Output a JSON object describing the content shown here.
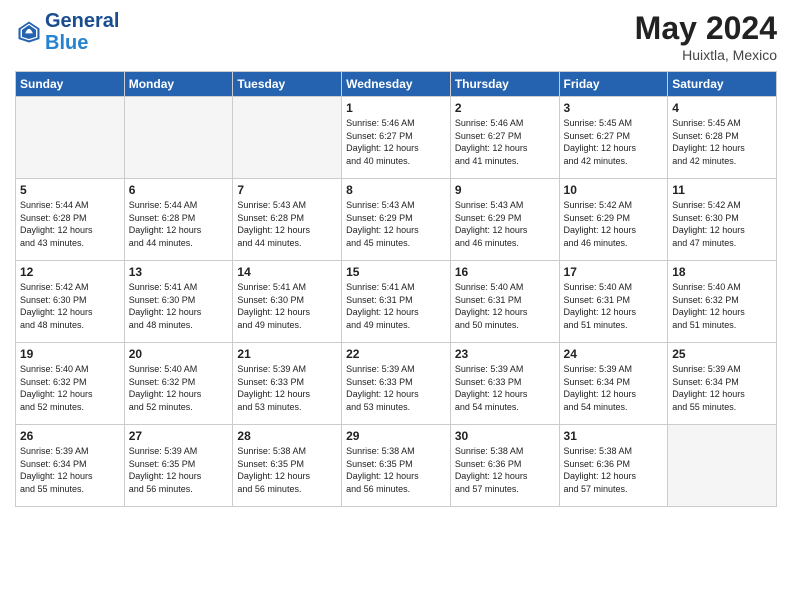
{
  "header": {
    "logo_text_general": "General",
    "logo_text_blue": "Blue",
    "month_year": "May 2024",
    "location": "Huixtla, Mexico"
  },
  "days_of_week": [
    "Sunday",
    "Monday",
    "Tuesday",
    "Wednesday",
    "Thursday",
    "Friday",
    "Saturday"
  ],
  "weeks": [
    [
      {
        "num": "",
        "info": ""
      },
      {
        "num": "",
        "info": ""
      },
      {
        "num": "",
        "info": ""
      },
      {
        "num": "1",
        "info": "Sunrise: 5:46 AM\nSunset: 6:27 PM\nDaylight: 12 hours\nand 40 minutes."
      },
      {
        "num": "2",
        "info": "Sunrise: 5:46 AM\nSunset: 6:27 PM\nDaylight: 12 hours\nand 41 minutes."
      },
      {
        "num": "3",
        "info": "Sunrise: 5:45 AM\nSunset: 6:27 PM\nDaylight: 12 hours\nand 42 minutes."
      },
      {
        "num": "4",
        "info": "Sunrise: 5:45 AM\nSunset: 6:28 PM\nDaylight: 12 hours\nand 42 minutes."
      }
    ],
    [
      {
        "num": "5",
        "info": "Sunrise: 5:44 AM\nSunset: 6:28 PM\nDaylight: 12 hours\nand 43 minutes."
      },
      {
        "num": "6",
        "info": "Sunrise: 5:44 AM\nSunset: 6:28 PM\nDaylight: 12 hours\nand 44 minutes."
      },
      {
        "num": "7",
        "info": "Sunrise: 5:43 AM\nSunset: 6:28 PM\nDaylight: 12 hours\nand 44 minutes."
      },
      {
        "num": "8",
        "info": "Sunrise: 5:43 AM\nSunset: 6:29 PM\nDaylight: 12 hours\nand 45 minutes."
      },
      {
        "num": "9",
        "info": "Sunrise: 5:43 AM\nSunset: 6:29 PM\nDaylight: 12 hours\nand 46 minutes."
      },
      {
        "num": "10",
        "info": "Sunrise: 5:42 AM\nSunset: 6:29 PM\nDaylight: 12 hours\nand 46 minutes."
      },
      {
        "num": "11",
        "info": "Sunrise: 5:42 AM\nSunset: 6:30 PM\nDaylight: 12 hours\nand 47 minutes."
      }
    ],
    [
      {
        "num": "12",
        "info": "Sunrise: 5:42 AM\nSunset: 6:30 PM\nDaylight: 12 hours\nand 48 minutes."
      },
      {
        "num": "13",
        "info": "Sunrise: 5:41 AM\nSunset: 6:30 PM\nDaylight: 12 hours\nand 48 minutes."
      },
      {
        "num": "14",
        "info": "Sunrise: 5:41 AM\nSunset: 6:30 PM\nDaylight: 12 hours\nand 49 minutes."
      },
      {
        "num": "15",
        "info": "Sunrise: 5:41 AM\nSunset: 6:31 PM\nDaylight: 12 hours\nand 49 minutes."
      },
      {
        "num": "16",
        "info": "Sunrise: 5:40 AM\nSunset: 6:31 PM\nDaylight: 12 hours\nand 50 minutes."
      },
      {
        "num": "17",
        "info": "Sunrise: 5:40 AM\nSunset: 6:31 PM\nDaylight: 12 hours\nand 51 minutes."
      },
      {
        "num": "18",
        "info": "Sunrise: 5:40 AM\nSunset: 6:32 PM\nDaylight: 12 hours\nand 51 minutes."
      }
    ],
    [
      {
        "num": "19",
        "info": "Sunrise: 5:40 AM\nSunset: 6:32 PM\nDaylight: 12 hours\nand 52 minutes."
      },
      {
        "num": "20",
        "info": "Sunrise: 5:40 AM\nSunset: 6:32 PM\nDaylight: 12 hours\nand 52 minutes."
      },
      {
        "num": "21",
        "info": "Sunrise: 5:39 AM\nSunset: 6:33 PM\nDaylight: 12 hours\nand 53 minutes."
      },
      {
        "num": "22",
        "info": "Sunrise: 5:39 AM\nSunset: 6:33 PM\nDaylight: 12 hours\nand 53 minutes."
      },
      {
        "num": "23",
        "info": "Sunrise: 5:39 AM\nSunset: 6:33 PM\nDaylight: 12 hours\nand 54 minutes."
      },
      {
        "num": "24",
        "info": "Sunrise: 5:39 AM\nSunset: 6:34 PM\nDaylight: 12 hours\nand 54 minutes."
      },
      {
        "num": "25",
        "info": "Sunrise: 5:39 AM\nSunset: 6:34 PM\nDaylight: 12 hours\nand 55 minutes."
      }
    ],
    [
      {
        "num": "26",
        "info": "Sunrise: 5:39 AM\nSunset: 6:34 PM\nDaylight: 12 hours\nand 55 minutes."
      },
      {
        "num": "27",
        "info": "Sunrise: 5:39 AM\nSunset: 6:35 PM\nDaylight: 12 hours\nand 56 minutes."
      },
      {
        "num": "28",
        "info": "Sunrise: 5:38 AM\nSunset: 6:35 PM\nDaylight: 12 hours\nand 56 minutes."
      },
      {
        "num": "29",
        "info": "Sunrise: 5:38 AM\nSunset: 6:35 PM\nDaylight: 12 hours\nand 56 minutes."
      },
      {
        "num": "30",
        "info": "Sunrise: 5:38 AM\nSunset: 6:36 PM\nDaylight: 12 hours\nand 57 minutes."
      },
      {
        "num": "31",
        "info": "Sunrise: 5:38 AM\nSunset: 6:36 PM\nDaylight: 12 hours\nand 57 minutes."
      },
      {
        "num": "",
        "info": ""
      }
    ]
  ]
}
